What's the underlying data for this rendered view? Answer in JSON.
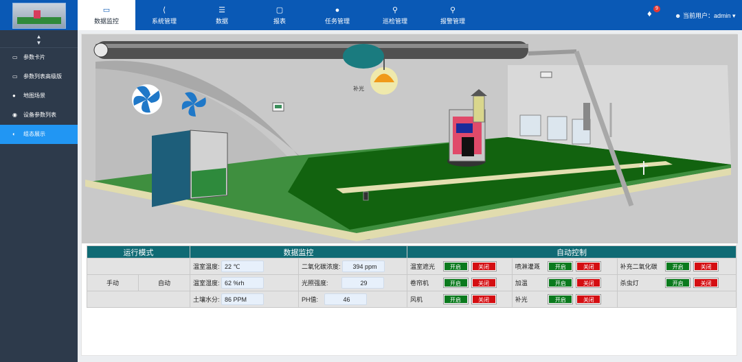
{
  "nav": {
    "items": [
      {
        "label": "数据监控",
        "icon": "monitor-icon",
        "active": true
      },
      {
        "label": "系统管理",
        "icon": "share-icon"
      },
      {
        "label": "数据",
        "icon": "list-icon"
      },
      {
        "label": "报表",
        "icon": "document-icon"
      },
      {
        "label": "任务管理",
        "icon": "users-icon"
      },
      {
        "label": "巡检管理",
        "icon": "person-pin-icon"
      },
      {
        "label": "报警管理",
        "icon": "person-pin-icon"
      }
    ],
    "notification_count": "9",
    "user_label": "当前用户：admin"
  },
  "sidebar": {
    "items": [
      {
        "label": "参数卡片",
        "icon": "monitor-icon"
      },
      {
        "label": "参数列表高级版",
        "icon": "monitor-icon"
      },
      {
        "label": "地图场景",
        "icon": "map-pin-icon"
      },
      {
        "label": "设备参数列表",
        "icon": "gear-icon"
      },
      {
        "label": "组态展示",
        "icon": "pie-chart-icon",
        "active": true
      }
    ]
  },
  "scene": {
    "light_label": "补光"
  },
  "panel": {
    "mode_header": "运行模式",
    "monitor_header": "数据监控",
    "auto_header": "自动控制",
    "mode_manual": "手动",
    "mode_auto": "自动",
    "readings": [
      {
        "label": "温室温度:",
        "value": "22 ℃"
      },
      {
        "label": "二氧化碳浓度:",
        "value": "394 ppm"
      },
      {
        "label": "温室湿度:",
        "value": "62 %rh"
      },
      {
        "label": "光照强度:",
        "value": "29"
      },
      {
        "label": "土壤水分:",
        "value": "86 PPM"
      },
      {
        "label": "PH值:",
        "value": "46"
      }
    ],
    "on_label": "开启",
    "off_label": "关闭",
    "controls": [
      {
        "label": "温室遮光"
      },
      {
        "label": "喷淋灌溉"
      },
      {
        "label": "补充二氧化碳"
      },
      {
        "label": "卷帘机"
      },
      {
        "label": "加温"
      },
      {
        "label": "杀虫灯"
      },
      {
        "label": "风机"
      },
      {
        "label": "补光"
      }
    ]
  },
  "colors": {
    "brand": "#0a59b5",
    "sidebar": "#2d3a4b",
    "active_sidebar": "#2196f3",
    "table_header": "#0f6a74",
    "on_button": "#0b7a1e",
    "off_button": "#d40e12"
  }
}
